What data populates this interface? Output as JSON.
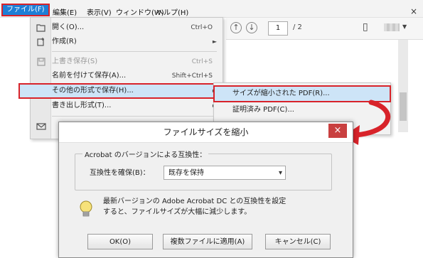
{
  "menubar": {
    "items": [
      "ファイル(F)",
      "編集(E)",
      "表示(V)",
      "ウィンドウ(W)",
      "ヘルプ(H)"
    ],
    "close": "×"
  },
  "toolbar": {
    "page_current": "1",
    "page_total": "/ 2"
  },
  "file_menu": {
    "items": [
      {
        "label": "開く(O)...",
        "shortcut": "Ctrl+O",
        "icon": "folder-open-icon"
      },
      {
        "label": "作成(R)",
        "shortcut": "",
        "icon": "create-icon",
        "submenu": true
      },
      {
        "label": "上書き保存(S)",
        "shortcut": "Ctrl+S",
        "icon": "save-icon",
        "disabled": true
      },
      {
        "label": "名前を付けて保存(A)...",
        "shortcut": "Shift+Ctrl+S"
      },
      {
        "label": "その他の形式で保存(H)...",
        "shortcut": "",
        "submenu": true,
        "highlighted": true
      },
      {
        "label": "書き出し形式(T)...",
        "shortcut": "",
        "submenu": true
      }
    ]
  },
  "submenu": {
    "items": [
      {
        "label": "サイズが縮小された PDF(R)...",
        "highlighted": true
      },
      {
        "label": "証明済み PDF(C)..."
      }
    ]
  },
  "dialog": {
    "title": "ファイルサイズを縮小",
    "close": "×",
    "group_label": "Acrobat のバージョンによる互換性：",
    "compat_label": "互換性を確保(B)：",
    "compat_value": "既存を保持",
    "info_line1": "最新バージョンの Adobe Acrobat DC との互換性を設定",
    "info_line2": "すると、ファイルサイズが大幅に減少します。",
    "buttons": {
      "ok": "OK(O)",
      "apply_multiple": "複数ファイルに適用(A)",
      "cancel": "キャンセル(C)"
    }
  },
  "colors": {
    "highlight_outline": "#d8232a",
    "menu_selected": "#1e7fd6",
    "hover": "#cde4f7"
  }
}
